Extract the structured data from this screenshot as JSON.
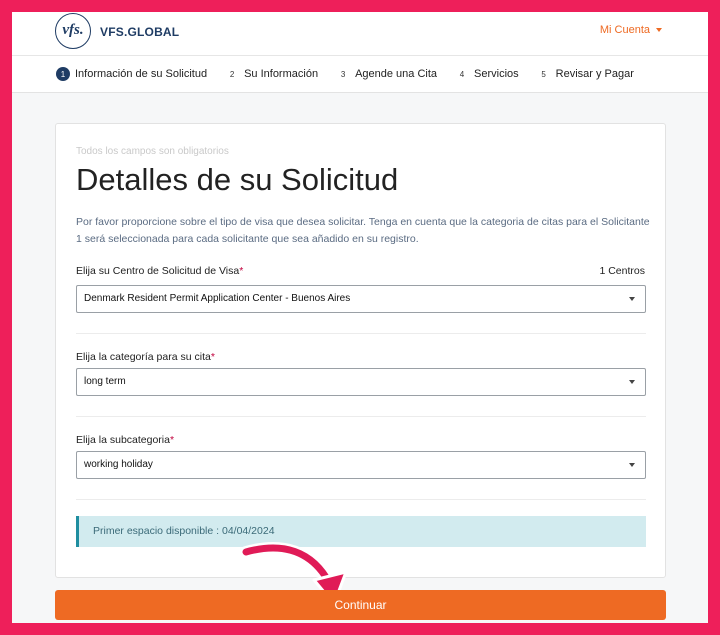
{
  "header": {
    "logo_mark": "vfs.",
    "logo_text": "VFS.GLOBAL",
    "account_label": "Mi Cuenta"
  },
  "steps": [
    {
      "num": "1",
      "label": "Información de su Solicitud"
    },
    {
      "num": "2",
      "label": "Su Información"
    },
    {
      "num": "3",
      "label": "Agende una Cita"
    },
    {
      "num": "4",
      "label": "Servicios"
    },
    {
      "num": "5",
      "label": "Revisar y Pagar"
    }
  ],
  "form": {
    "required_note": "Todos los campos son obligatorios",
    "title": "Detalles de su Solicitud",
    "description": "Por favor proporcione sobre el tipo de visa que desea solicitar. Tenga en cuenta que la categoria de citas para el Solicitante 1 será seleccionada para cada solicitante que sea añadido en su registro.",
    "center_label": "Elija su Centro de Solicitud de Visa",
    "center_count": "1 Centros",
    "center_value": "Denmark Resident Permit Application Center - Buenos Aires",
    "category_label": "Elija la categoría para su cita",
    "category_value": "long term",
    "subcategory_label": "Elija la subcategoria",
    "subcategory_value": "working holiday",
    "required_mark": "*",
    "availability": "Primer espacio disponible : 04/04/2024"
  },
  "cta": {
    "label": "Continuar"
  },
  "colors": {
    "border_frame": "#ee1f5a",
    "brand_navy": "#1f3c64",
    "accent_orange": "#ee6a23",
    "info_bg": "#d2ebef"
  }
}
